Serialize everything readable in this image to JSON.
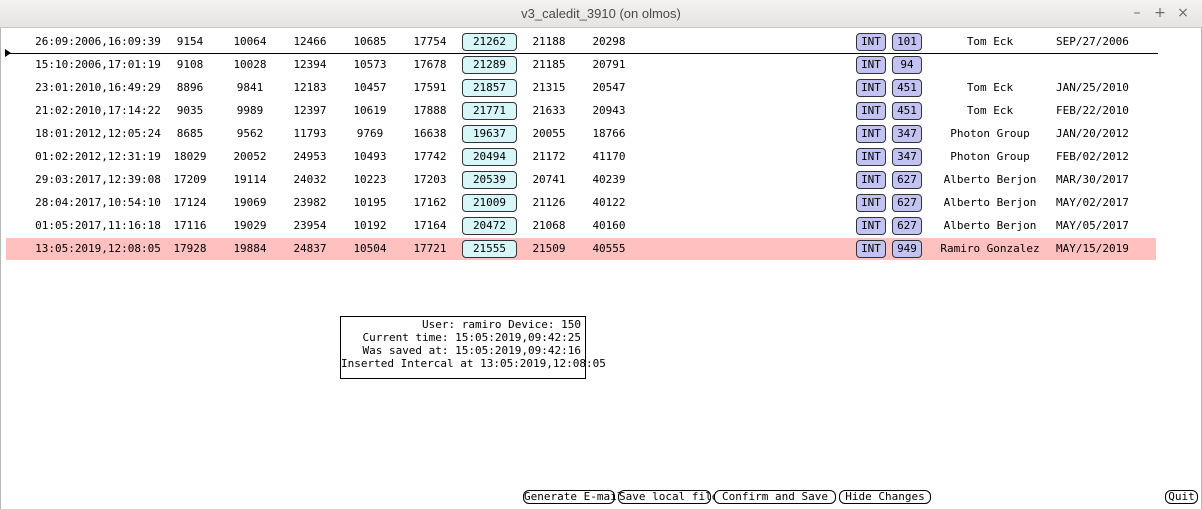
{
  "window": {
    "title": "v3_caledit_3910 (on olmos)"
  },
  "rows": [
    {
      "date": "26:09:2006,16:09:39",
      "v1": "9154",
      "v2": "10064",
      "v3": "12466",
      "v4": "10685",
      "v5": "17754",
      "box": "21262",
      "v7": "21188",
      "v8": "20298",
      "type": "INT",
      "num": "101",
      "who": "Tom Eck",
      "when": "SEP/27/2006"
    },
    {
      "date": "15:10:2006,17:01:19",
      "v1": "9108",
      "v2": "10028",
      "v3": "12394",
      "v4": "10573",
      "v5": "17678",
      "box": "21289",
      "v7": "21185",
      "v8": "20791",
      "type": "INT",
      "num": "94",
      "who": "",
      "when": ""
    },
    {
      "date": "23:01:2010,16:49:29",
      "v1": "8896",
      "v2": "9841",
      "v3": "12183",
      "v4": "10457",
      "v5": "17591",
      "box": "21857",
      "v7": "21315",
      "v8": "20547",
      "type": "INT",
      "num": "451",
      "who": "Tom Eck",
      "when": "JAN/25/2010"
    },
    {
      "date": "21:02:2010,17:14:22",
      "v1": "9035",
      "v2": "9989",
      "v3": "12397",
      "v4": "10619",
      "v5": "17888",
      "box": "21771",
      "v7": "21633",
      "v8": "20943",
      "type": "INT",
      "num": "451",
      "who": "Tom Eck",
      "when": "FEB/22/2010"
    },
    {
      "date": "18:01:2012,12:05:24",
      "v1": "8685",
      "v2": "9562",
      "v3": "11793",
      "v4": "9769",
      "v5": "16638",
      "box": "19637",
      "v7": "20055",
      "v8": "18766",
      "type": "INT",
      "num": "347",
      "who": "Photon Group",
      "when": "JAN/20/2012"
    },
    {
      "date": "01:02:2012,12:31:19",
      "v1": "18029",
      "v2": "20052",
      "v3": "24953",
      "v4": "10493",
      "v5": "17742",
      "box": "20494",
      "v7": "21172",
      "v8": "41170",
      "type": "INT",
      "num": "347",
      "who": "Photon Group",
      "when": "FEB/02/2012"
    },
    {
      "date": "29:03:2017,12:39:08",
      "v1": "17209",
      "v2": "19114",
      "v3": "24032",
      "v4": "10223",
      "v5": "17203",
      "box": "20539",
      "v7": "20741",
      "v8": "40239",
      "type": "INT",
      "num": "627",
      "who": "Alberto Berjon",
      "when": "MAR/30/2017"
    },
    {
      "date": "28:04:2017,10:54:10",
      "v1": "17124",
      "v2": "19069",
      "v3": "23982",
      "v4": "10195",
      "v5": "17162",
      "box": "21009",
      "v7": "21126",
      "v8": "40122",
      "type": "INT",
      "num": "627",
      "who": "Alberto Berjon",
      "when": "MAY/02/2017"
    },
    {
      "date": "01:05:2017,11:16:18",
      "v1": "17116",
      "v2": "19029",
      "v3": "23954",
      "v4": "10192",
      "v5": "17164",
      "box": "20472",
      "v7": "21068",
      "v8": "40160",
      "type": "INT",
      "num": "627",
      "who": "Alberto Berjon",
      "when": "MAY/05/2017"
    },
    {
      "date": "13:05:2019,12:08:05",
      "v1": "17928",
      "v2": "19884",
      "v3": "24837",
      "v4": "10504",
      "v5": "17721",
      "box": "21555",
      "v7": "21509",
      "v8": "40555",
      "type": "INT",
      "num": "949",
      "who": "Ramiro Gonzalez",
      "when": "MAY/15/2019"
    }
  ],
  "highlight_color": "#ffc0c0",
  "info": {
    "user_line": "User: ramiro Device: 150",
    "current_line": "Current time: 15:05:2019,09:42:25",
    "saved_line": "Was saved at: 15:05:2019,09:42:16",
    "inserted_line": "Inserted Intercal at 13:05:2019,12:08:05"
  },
  "buttons": {
    "generate_email": "Generate E-mail",
    "save_local": "Save local file",
    "confirm_save": "Confirm and Save",
    "hide_changes": "Hide Changes",
    "quit": "Quit"
  }
}
